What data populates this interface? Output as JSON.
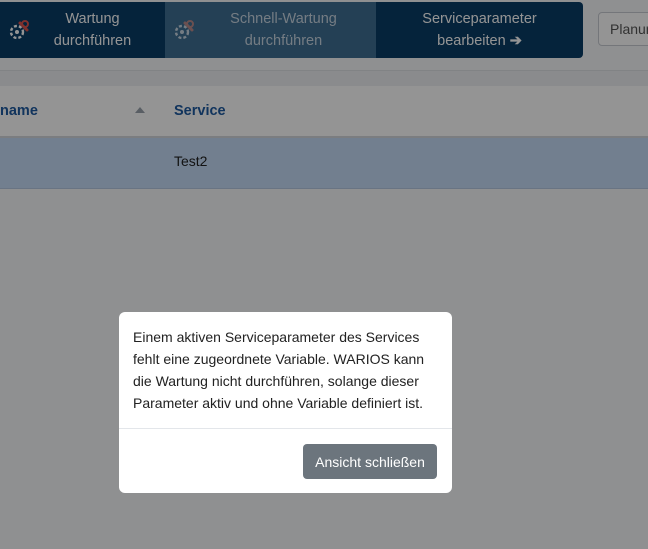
{
  "toolbar": {
    "wartung_label": "Wartung\ndurchführen",
    "schnell_label": "Schnell-Wartung\ndurchführen",
    "service_label": "Serviceparameter\nbearbeiten",
    "service_arrow": "➔",
    "plan_input_value": "Planun"
  },
  "table": {
    "headers": [
      "name",
      "Service"
    ],
    "rows": [
      {
        "name": "",
        "service": "Test2"
      }
    ]
  },
  "modal": {
    "message": "Einem aktiven Serviceparameter des Services fehlt eine zugeordnete Variable. WARIOS kann die Wartung nicht durchführen, solange dieser Parameter aktiv und ohne Variable definiert ist.",
    "close_label": "Ansicht schließen"
  },
  "colors": {
    "toolbar_primary": "#0a3d66",
    "toolbar_disabled": "#3f6f93",
    "selected_row": "#c5dbf6",
    "header_text": "#1e5aa0",
    "close_button": "#6c757d"
  },
  "icons": [
    "wrench-gear-icon",
    "sort-asc-icon",
    "arrow-right-icon"
  ]
}
